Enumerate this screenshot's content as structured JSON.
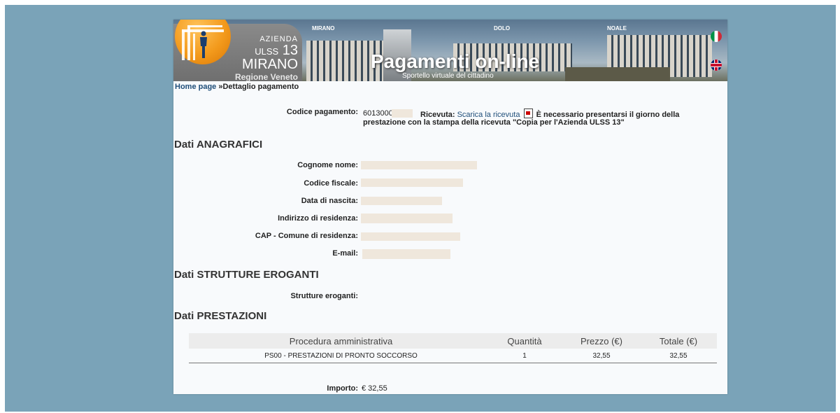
{
  "banner": {
    "logo": {
      "line1": "AZIENDA",
      "line2_prefix": "ULSS",
      "line2_number": "13",
      "line3": "MIRANO",
      "line4": "Regione Veneto"
    },
    "cities": [
      "MIRANO",
      "DOLO",
      "NOALE"
    ],
    "title": "Pagamenti on-line",
    "subtitle": "Sportello virtuale del cittadino",
    "flags": [
      "flag-italy-icon",
      "flag-uk-icon"
    ]
  },
  "breadcrumb": {
    "home": "Home page",
    "separator": "»",
    "current": "Dettaglio pagamento"
  },
  "payment": {
    "code_label": "Codice pagamento:",
    "code_value": "6013000",
    "receipt_label": "Ricevuta:",
    "receipt_link": "Scarica la ricevuta",
    "receipt_note_1": "È necessario presentarsi il giorno della",
    "receipt_note_2": "prestazione con la stampa della ricevuta \"Copia per l'Azienda ULSS 13\""
  },
  "anagrafici": {
    "title": "Dati ANAGRAFICI",
    "fields": [
      {
        "label": "Cognome nome:"
      },
      {
        "label": "Codice fiscale:"
      },
      {
        "label": "Data di nascita:"
      },
      {
        "label": "Indirizzo di residenza:"
      },
      {
        "label": "CAP - Comune di residenza:"
      },
      {
        "label": "E-mail:"
      }
    ]
  },
  "strutture": {
    "title": "Dati STRUTTURE EROGANTI",
    "label": "Strutture eroganti:"
  },
  "prestazioni": {
    "title": "Dati PRESTAZIONI",
    "columns": [
      "Procedura amministrativa",
      "Quantità",
      "Prezzo (€)",
      "Totale (€)"
    ],
    "rows": [
      [
        "PS00 - PRESTAZIONI DI PRONTO SOCCORSO",
        "1",
        "32,55",
        "32,55"
      ]
    ]
  },
  "importo": {
    "label": "Importo:",
    "value": "€ 32,55"
  }
}
